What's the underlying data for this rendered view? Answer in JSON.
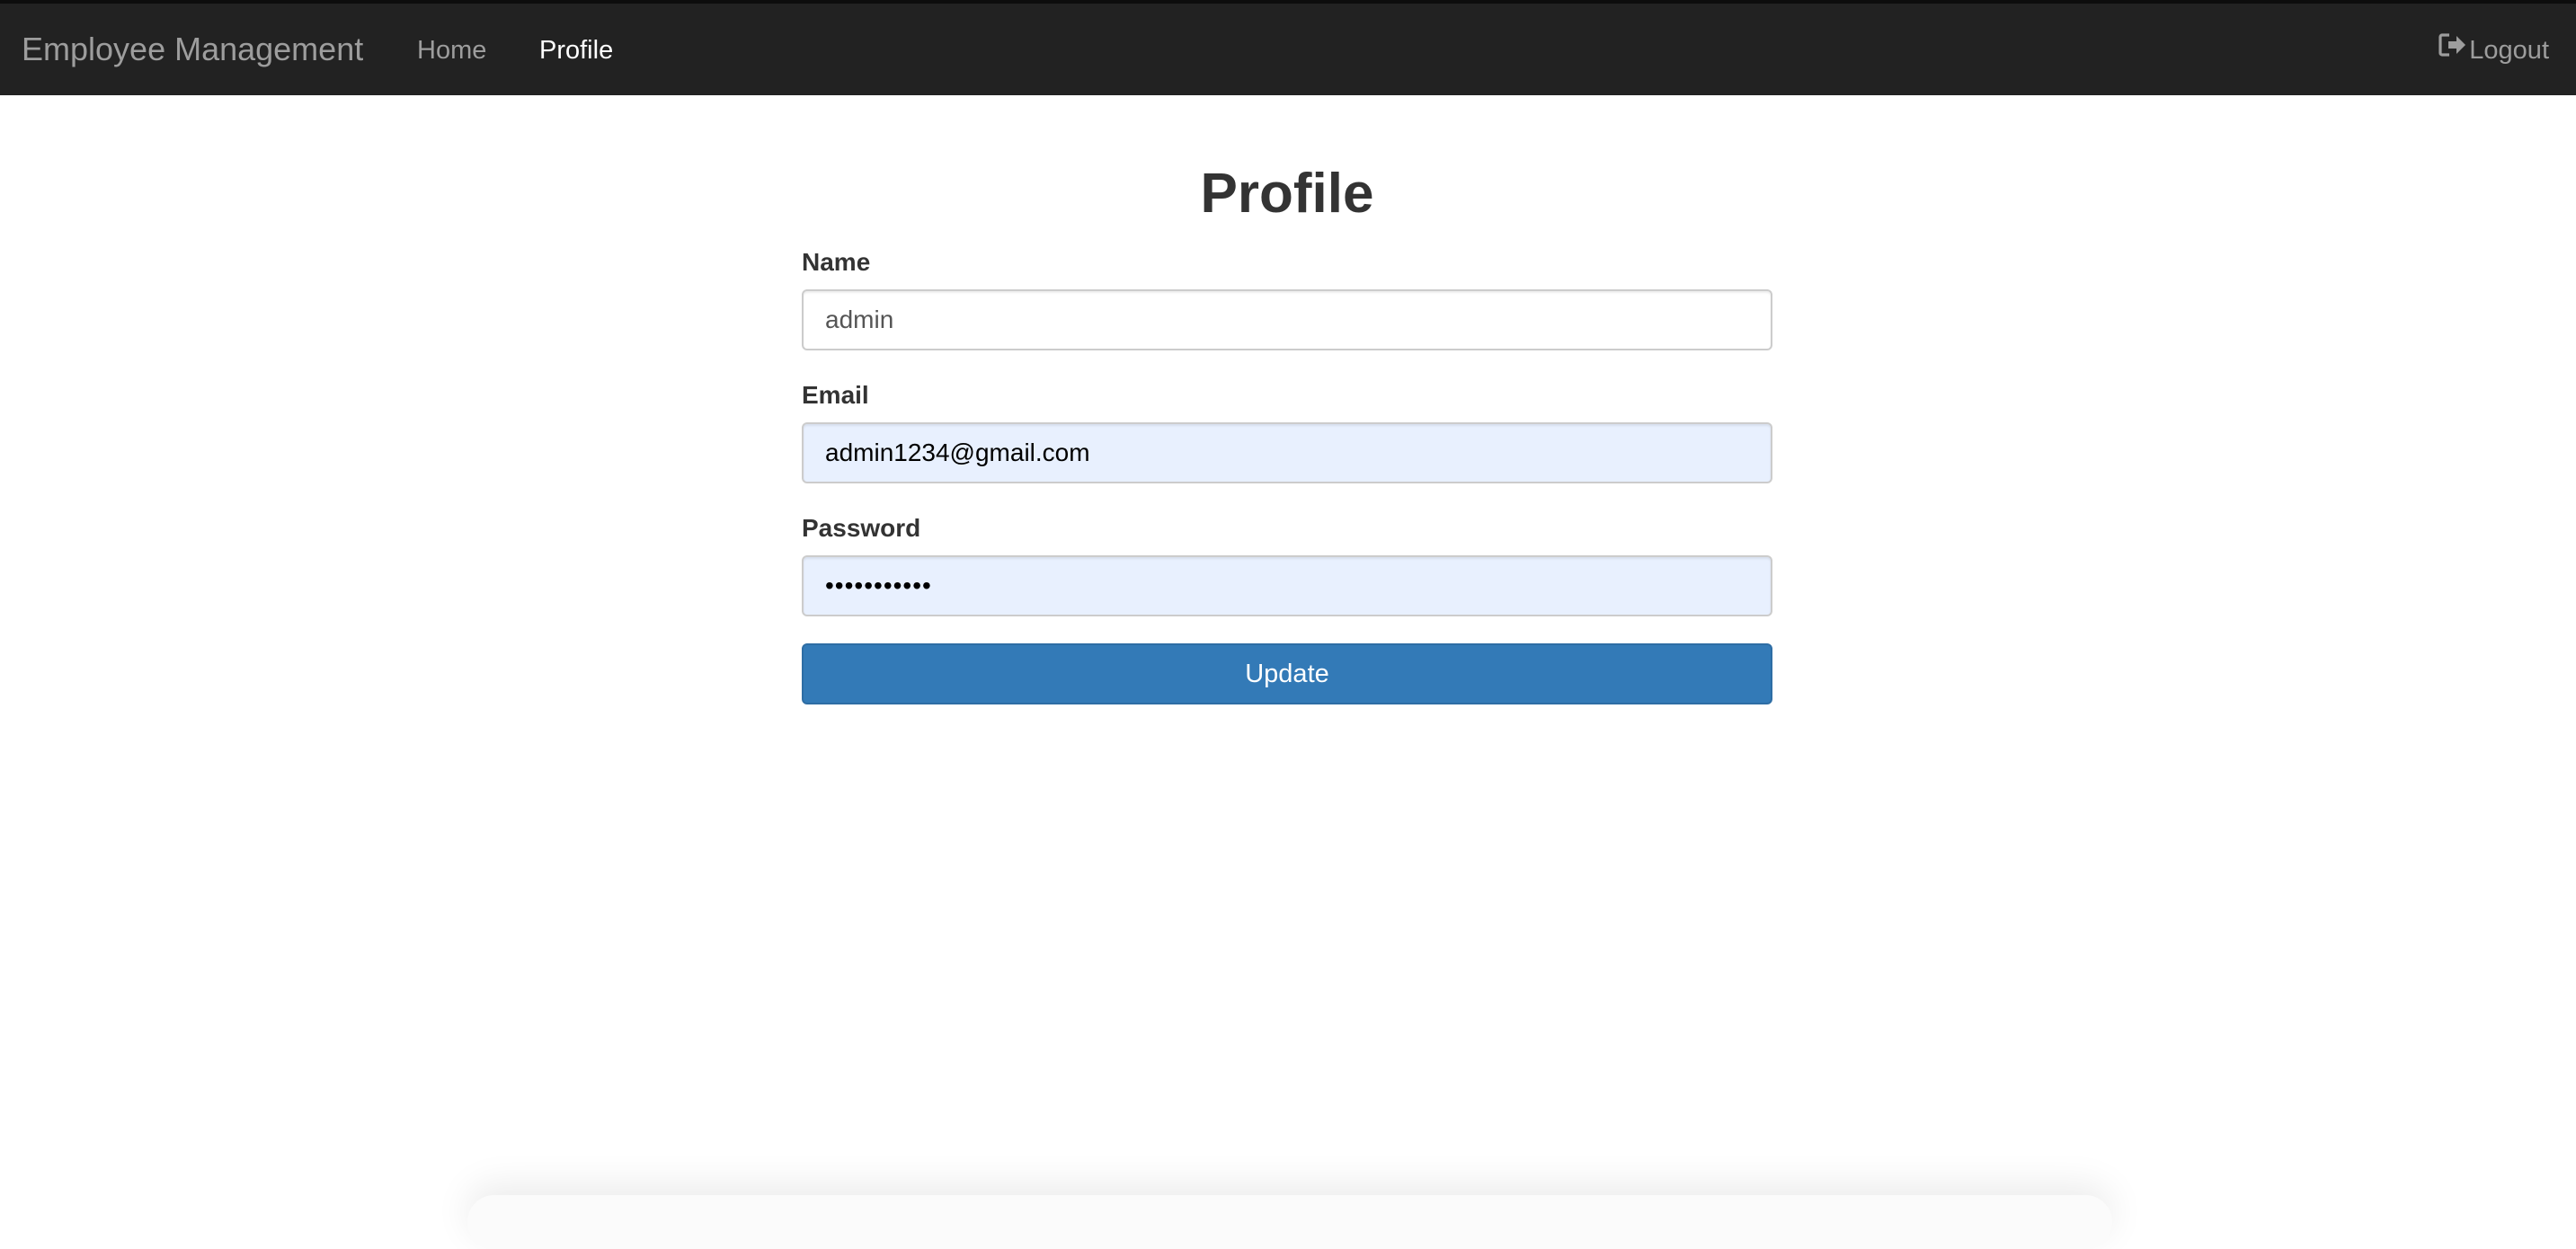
{
  "navbar": {
    "brand": "Employee Management",
    "links": [
      {
        "label": "Home",
        "active": false
      },
      {
        "label": "Profile",
        "active": true
      }
    ],
    "logout_label": "Logout",
    "logout_icon": "logout-icon"
  },
  "main": {
    "title": "Profile",
    "fields": {
      "name": {
        "label": "Name",
        "value": "admin"
      },
      "email": {
        "label": "Email",
        "value": "admin1234@gmail.com"
      },
      "password": {
        "label": "Password",
        "value": "•••••••••••"
      }
    },
    "update_label": "Update"
  },
  "colors": {
    "navbar_bg": "#222222",
    "nav_text": "#9d9d9d",
    "nav_active": "#ffffff",
    "primary": "#337ab7",
    "autofill_bg": "#e8f0fe"
  }
}
